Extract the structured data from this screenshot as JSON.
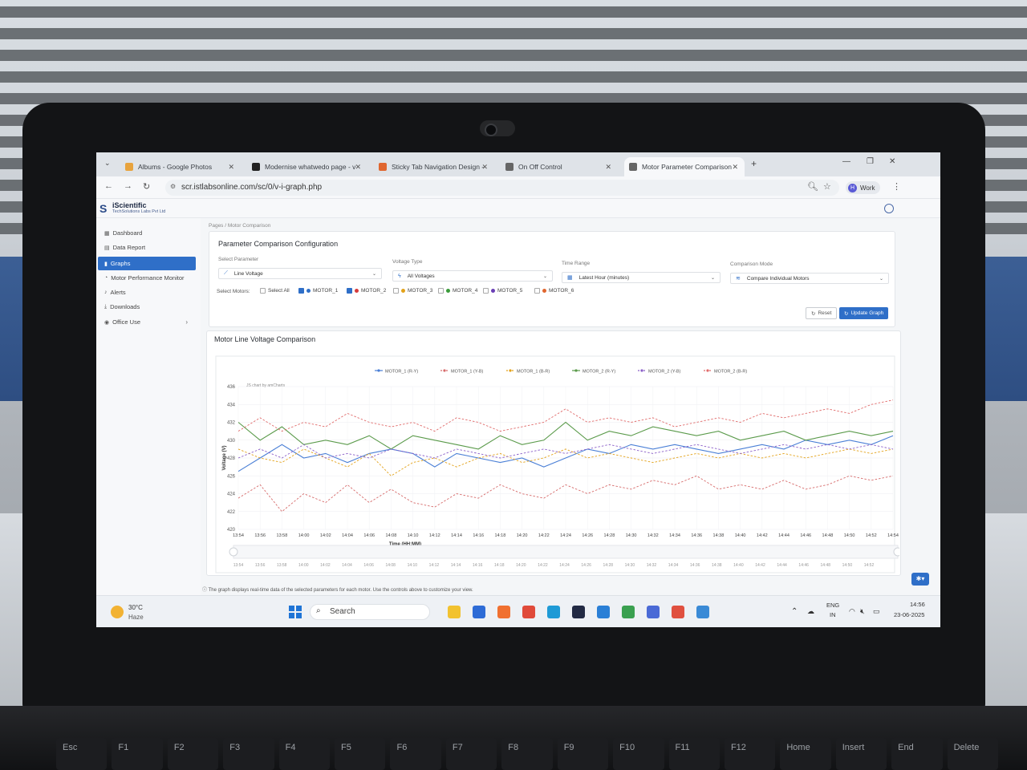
{
  "browser": {
    "tabs": [
      {
        "label": "Albums - Google Photos",
        "color": "#e8a33d"
      },
      {
        "label": "Modernise whatwedo page - v",
        "color": "#222222"
      },
      {
        "label": "Sticky Tab Navigation Design -",
        "color": "#e0662f"
      },
      {
        "label": "On Off Control",
        "color": "#666666"
      },
      {
        "label": "Motor Parameter Comparison",
        "color": "#666666",
        "active": true
      }
    ],
    "url": "scr.istlabsonline.com/sc/0/v-i-graph.php",
    "profile": {
      "initial": "H",
      "label": "Work"
    }
  },
  "app": {
    "logo_name": "iScientific",
    "logo_sub": "TechSolutions Labs Pvt Ltd"
  },
  "sidebar": {
    "items": [
      {
        "label": "Dashboard",
        "icon": "grid-icon"
      },
      {
        "label": "Data Report",
        "icon": "table-icon"
      },
      {
        "label": "Graphs",
        "icon": "bar-chart-icon",
        "active": true
      },
      {
        "label": "Motor Performance Monitor",
        "icon": "gauge-icon"
      },
      {
        "label": "Alerts",
        "icon": "bell-icon"
      },
      {
        "label": "Downloads",
        "icon": "download-icon"
      },
      {
        "label": "Office Use",
        "icon": "office-icon"
      }
    ]
  },
  "breadcrumb": "Pages  /  Motor Comparison",
  "config": {
    "title": "Parameter Comparison Configuration",
    "parameter_label": "Select Parameter",
    "parameter_value": "Line Voltage",
    "voltage_label": "Voltage Type",
    "voltage_value": "All Voltages",
    "time_label": "Time Range",
    "time_value": "Latest Hour (minutes)",
    "mode_label": "Comparison Mode",
    "mode_value": "Compare Individual Motors",
    "motors_label": "Select Motors:",
    "select_all": "Select All",
    "motors": [
      {
        "label": "MOTOR_1",
        "color": "#2f6fc8",
        "checked": true
      },
      {
        "label": "MOTOR_2",
        "color": "#d63b3b",
        "checked": true
      },
      {
        "label": "MOTOR_3",
        "color": "#e3a21a",
        "checked": false
      },
      {
        "label": "MOTOR_4",
        "color": "#3a9b3a",
        "checked": false
      },
      {
        "label": "MOTOR_5",
        "color": "#6a3fb5",
        "checked": false
      },
      {
        "label": "MOTOR_6",
        "color": "#e0662f",
        "checked": false
      }
    ],
    "reset_label": "Reset",
    "update_label": "Update Graph"
  },
  "chart_card": {
    "title": "Motor Line Voltage Comparison"
  },
  "chart_data": {
    "type": "line",
    "watermark": "JS chart by amCharts",
    "ylabel": "Voltage (V)",
    "xlabel": "Time (HH:MM)",
    "ylim": [
      420,
      436
    ],
    "yticks": [
      420,
      422,
      424,
      426,
      428,
      430,
      432,
      434,
      436
    ],
    "categories": [
      "13:54",
      "13:56",
      "13:58",
      "14:00",
      "14:02",
      "14:04",
      "14:06",
      "14:08",
      "14:10",
      "14:12",
      "14:14",
      "14:16",
      "14:18",
      "14:20",
      "14:22",
      "14:24",
      "14:26",
      "14:28",
      "14:30",
      "14:32",
      "14:34",
      "14:36",
      "14:38",
      "14:40",
      "14:42",
      "14:44",
      "14:46",
      "14:48",
      "14:50",
      "14:52",
      "14:54"
    ],
    "series": [
      {
        "name": "MOTOR_1 (R-Y)",
        "color": "#4a7fd6",
        "dash": false,
        "values": [
          426.5,
          428,
          429.5,
          428,
          428.5,
          427.5,
          428.5,
          429,
          428.5,
          427,
          428.5,
          428,
          427.5,
          428,
          427,
          428,
          429,
          428.5,
          429.5,
          429,
          429.5,
          429,
          428.5,
          429,
          429.5,
          429,
          430,
          429.5,
          430,
          429.5,
          430.5
        ]
      },
      {
        "name": "MOTOR_1 (Y-B)",
        "color": "#d66a6a",
        "dash": true,
        "values": [
          423.5,
          425,
          422,
          424,
          423,
          425,
          423,
          424.5,
          423,
          422.5,
          424,
          423.5,
          425,
          424,
          423.5,
          425,
          424,
          425,
          424.5,
          425.5,
          425,
          426,
          424.5,
          425,
          424.5,
          425.5,
          424.5,
          425,
          426,
          425.5,
          426
        ]
      },
      {
        "name": "MOTOR_1 (B-R)",
        "color": "#e3a21a",
        "dash": true,
        "values": [
          429,
          428,
          427.5,
          429,
          428,
          427,
          428.5,
          426,
          427.5,
          428,
          427,
          428,
          428.5,
          427.5,
          428,
          429,
          428,
          428.5,
          428,
          427.5,
          428,
          428.5,
          428,
          428.5,
          428,
          428.5,
          428,
          428.5,
          429,
          428.5,
          429
        ]
      },
      {
        "name": "MOTOR_2 (R-Y)",
        "color": "#5a9a4a",
        "dash": false,
        "values": [
          432,
          430,
          431.5,
          429.5,
          430,
          429.5,
          430.5,
          429,
          430.5,
          430,
          429.5,
          429,
          430.5,
          429.5,
          430,
          432,
          430,
          431,
          430.5,
          431.5,
          431,
          430.5,
          431,
          430,
          430.5,
          431,
          430,
          430.5,
          431,
          430.5,
          431
        ]
      },
      {
        "name": "MOTOR_2 (Y-B)",
        "color": "#8b5fc8",
        "dash": true,
        "values": [
          428,
          429,
          428,
          429.5,
          428,
          428.5,
          428,
          429,
          428.5,
          428,
          429,
          428.5,
          428,
          428.5,
          429,
          428.5,
          429,
          429.5,
          429,
          428.5,
          429,
          429.5,
          429,
          428.5,
          429,
          429.5,
          429,
          429.5,
          429,
          429.5,
          429
        ]
      },
      {
        "name": "MOTOR_2 (B-R)",
        "color": "#e06a6a",
        "dash": true,
        "values": [
          431,
          432.5,
          431,
          432,
          431.5,
          433,
          432,
          431.5,
          432,
          431,
          432.5,
          432,
          431,
          431.5,
          432,
          433.5,
          432,
          432.5,
          432,
          432.5,
          431.5,
          432,
          432.5,
          432,
          433,
          432.5,
          433,
          433.5,
          433,
          434,
          434.5
        ]
      }
    ],
    "navigator_labels": [
      "13:54",
      "13:56",
      "13:58",
      "14:00",
      "14:02",
      "14:04",
      "14:06",
      "14:08",
      "14:10",
      "14:12",
      "14:14",
      "14:16",
      "14:18",
      "14:20",
      "14:22",
      "14:24",
      "14:26",
      "14:28",
      "14:30",
      "14:32",
      "14:34",
      "14:36",
      "14:38",
      "14:40",
      "14:42",
      "14:44",
      "14:46",
      "14:48",
      "14:50",
      "14:52"
    ],
    "legend_position": "top-center",
    "grid": true
  },
  "note": "The graph displays real-time data of the selected parameters for each motor. Use the controls above to customize your view.",
  "taskbar": {
    "weather_temp": "30°C",
    "weather_cond": "Haze",
    "search_label": "Search",
    "lang": "ENG",
    "region": "IN",
    "time": "14:56",
    "date": "23-06-2025"
  },
  "keyboard": {
    "keys": [
      "Esc",
      "F1",
      "F2",
      "F3",
      "F4",
      "F5",
      "F6",
      "F7",
      "F8",
      "F9",
      "F10",
      "F11",
      "F12",
      "Home",
      "Insert",
      "End",
      "Delete"
    ]
  }
}
